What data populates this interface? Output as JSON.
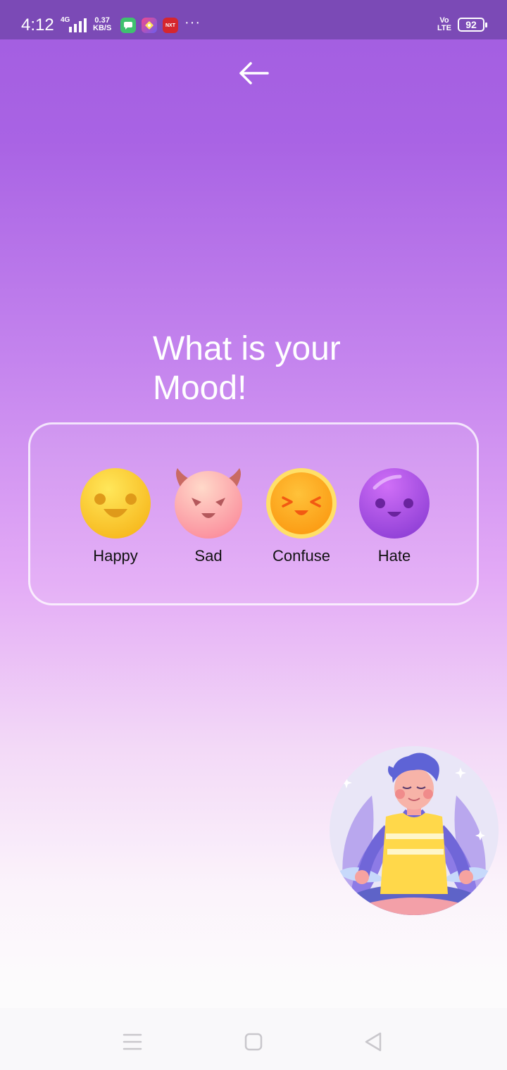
{
  "status_bar": {
    "time": "4:12",
    "network": "4G",
    "speed_value": "0.37",
    "speed_unit": "KB/S",
    "app_icons": [
      "message-icon",
      "pinwheel-icon",
      "news-next-icon"
    ],
    "news_app_label": "NXT",
    "more": "···",
    "volte_top": "Vo",
    "volte_bottom": "LTE",
    "battery": "92"
  },
  "header": {
    "back_icon": "arrow-left-icon"
  },
  "title": {
    "line1": "What is your",
    "line2": "Mood!"
  },
  "moods": [
    {
      "label": "Happy",
      "icon": "happy-face-icon"
    },
    {
      "label": "Sad",
      "icon": "devil-face-icon"
    },
    {
      "label": "Confuse",
      "icon": "squinting-face-icon"
    },
    {
      "label": "Hate",
      "icon": "purple-face-icon"
    }
  ],
  "illustration": {
    "icon": "meditating-person-illustration"
  },
  "nav_bar": {
    "buttons": [
      "menu-icon",
      "home-square-icon",
      "back-triangle-icon"
    ]
  },
  "colors": {
    "status_bar": "#7b4ab6",
    "gradient_top": "#a25de0",
    "gradient_bottom": "#fcfbfc",
    "title": "#ffffff"
  }
}
